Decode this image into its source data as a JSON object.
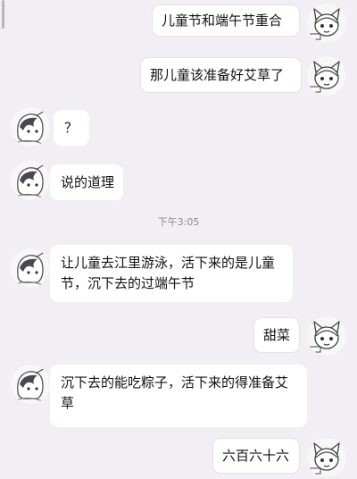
{
  "chat": {
    "messages": [
      {
        "side": "right",
        "text": "儿童节和端午节重合"
      },
      {
        "side": "right",
        "text": "那儿童该准备好艾草了"
      },
      {
        "side": "left",
        "text": "？"
      },
      {
        "side": "left",
        "text": "说的道理"
      },
      {
        "side": "left",
        "text": "让儿童去江里游泳，活下来的是儿童节，沉下去的过端午节"
      },
      {
        "side": "right",
        "text": "甜菜"
      },
      {
        "side": "left",
        "text": "沉下去的能吃粽子，活下来的得准备艾草"
      },
      {
        "side": "right",
        "text": "六百六十六"
      }
    ],
    "timestamp": "下午3:05"
  },
  "icons": {
    "self_avatar": "cat-girl-avatar-icon",
    "other_avatar": "dark-hair-girl-avatar-icon"
  },
  "colors": {
    "background": "#f1eef4",
    "bubble": "#ffffff",
    "text": "#111111",
    "timestamp": "#8c8a90"
  }
}
